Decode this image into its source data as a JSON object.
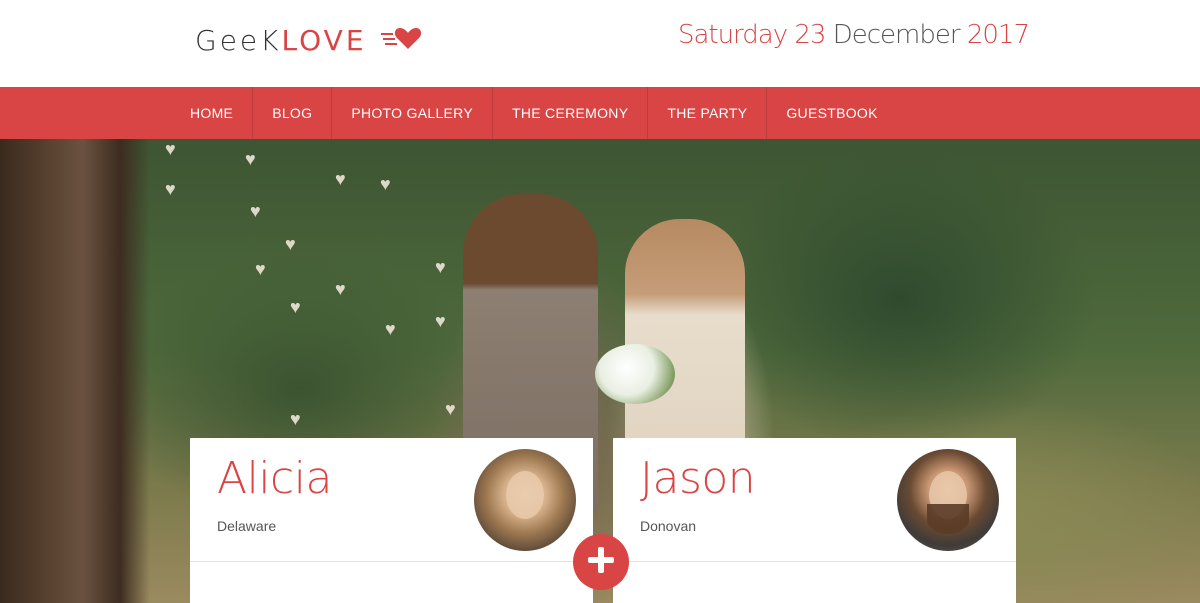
{
  "header": {
    "logo": {
      "part1": "GeeK",
      "part2": "LOVE",
      "icon": "flying-heart-icon"
    },
    "date": {
      "weekday": "Saturday",
      "day": "23",
      "month": "December",
      "year": "2017"
    }
  },
  "nav": {
    "items": [
      {
        "label": "HOME"
      },
      {
        "label": "BLOG"
      },
      {
        "label": "PHOTO GALLERY"
      },
      {
        "label": "THE CEREMONY"
      },
      {
        "label": "THE PARTY"
      },
      {
        "label": "GUESTBOOK"
      }
    ]
  },
  "couple": {
    "bride": {
      "name": "Alicia",
      "location": "Delaware",
      "avatar": "bride-portrait"
    },
    "groom": {
      "name": "Jason",
      "location": "Donovan",
      "avatar": "groom-portrait"
    },
    "join_icon": "plus-icon"
  },
  "colors": {
    "accent": "#d94545",
    "text_dark": "#333333",
    "text_muted": "#555555"
  }
}
